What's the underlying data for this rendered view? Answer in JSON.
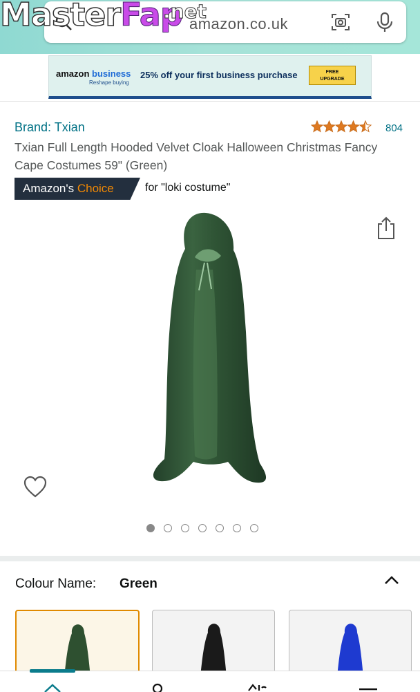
{
  "watermark": {
    "part1": "Master",
    "part2": "Fap",
    "suffix": ".net"
  },
  "search": {
    "text": "amazon.co.uk"
  },
  "ad": {
    "logo_main": "amazon",
    "logo_biz": "business",
    "logo_sub": "Reshape buying",
    "offer": "25% off your first business purchase",
    "button_line1": "FREE",
    "button_line2": "UPGRADE"
  },
  "product": {
    "brand": "Brand: Txian",
    "rating_stars": "★★★★☆",
    "rating": 4.5,
    "rating_count": "804",
    "title": "Txian Full Length Hooded Velvet Cloak Halloween Christmas Fancy Cape Costumes 59\" (Green)",
    "badge_main": "Amazon's ",
    "badge_accent": "Choice",
    "badge_for": "for \"loki costume\""
  },
  "gallery": {
    "image_count": 7,
    "active_index": 0
  },
  "colour": {
    "label": "Colour Name:",
    "selected": "Green",
    "options": [
      {
        "name": "Green",
        "color": "#2e5030"
      },
      {
        "name": "Black",
        "color": "#1a1a1a"
      },
      {
        "name": "Blue",
        "color": "#1e3ad0"
      }
    ]
  },
  "colors": {
    "link": "#007185",
    "badge_bg": "#232f3e",
    "badge_accent": "#f08804",
    "star": "#de7921",
    "selected_swatch": "#e08a00",
    "nav_active": "#0b7c8c"
  }
}
